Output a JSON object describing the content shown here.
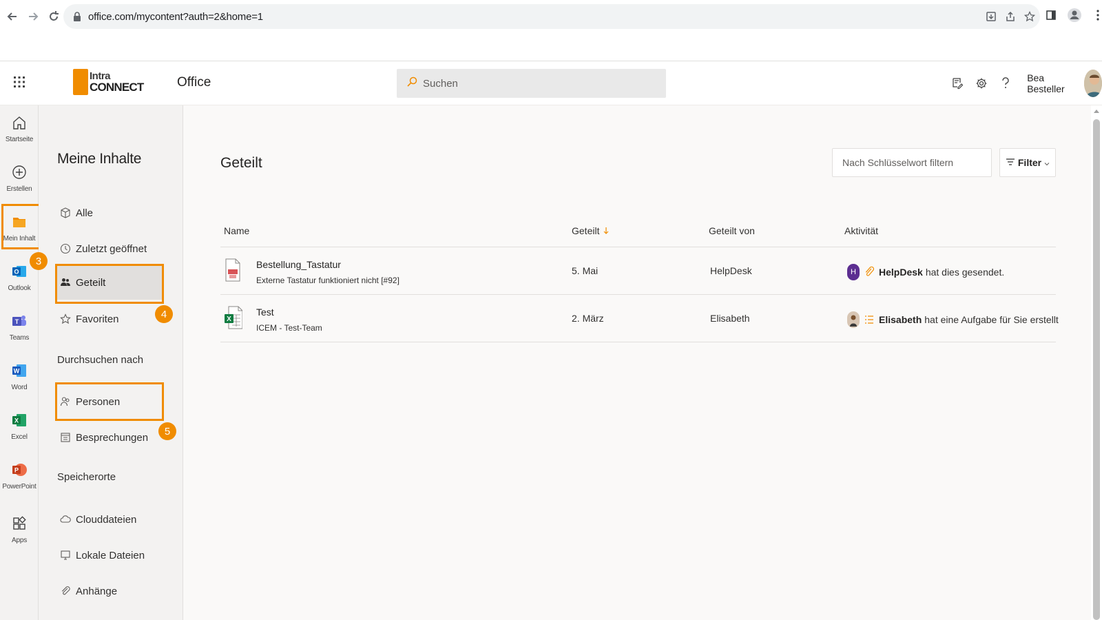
{
  "browser": {
    "url": "office.com/mycontent?auth=2&home=1"
  },
  "header": {
    "brand_line1": "Intra",
    "brand_line2": "CONNECT",
    "app_name": "Office",
    "search_placeholder": "Suchen",
    "user_name": "Bea Besteller"
  },
  "rail": {
    "items": [
      {
        "label": "Startseite",
        "icon": "home-icon"
      },
      {
        "label": "Erstellen",
        "icon": "plus-circle-icon"
      },
      {
        "label": "Mein Inhalt",
        "icon": "folder-icon"
      },
      {
        "label": "Outlook",
        "icon": "outlook-icon"
      },
      {
        "label": "Teams",
        "icon": "teams-icon"
      },
      {
        "label": "Word",
        "icon": "word-icon"
      },
      {
        "label": "Excel",
        "icon": "excel-icon"
      },
      {
        "label": "PowerPoint",
        "icon": "powerpoint-icon"
      },
      {
        "label": "Apps",
        "icon": "apps-icon"
      }
    ],
    "highlight_color": "#F08C00"
  },
  "badges": [
    "3",
    "4",
    "5"
  ],
  "sidebar": {
    "title": "Meine Inhalte",
    "items": [
      {
        "label": "Alle",
        "icon": "cube-icon"
      },
      {
        "label": "Zuletzt geöffnet",
        "icon": "clock-icon"
      },
      {
        "label": "Geteilt",
        "icon": "people-icon"
      },
      {
        "label": "Favoriten",
        "icon": "star-icon"
      }
    ],
    "browse_section": "Durchsuchen nach",
    "browse_items": [
      {
        "label": "Personen",
        "icon": "person-icon"
      },
      {
        "label": "Besprechungen",
        "icon": "calendar-icon"
      }
    ],
    "storage_section": "Speicherorte",
    "storage_items": [
      {
        "label": "Clouddateien",
        "icon": "cloud-icon"
      },
      {
        "label": "Lokale Dateien",
        "icon": "monitor-icon"
      },
      {
        "label": "Anhänge",
        "icon": "paperclip-icon"
      }
    ]
  },
  "main": {
    "title": "Geteilt",
    "filter_placeholder": "Nach Schlüsselwort filtern",
    "filter_button": "Filter",
    "columns": [
      "Name",
      "Geteilt",
      "Geteilt von",
      "Aktivität"
    ],
    "rows": [
      {
        "name": "Bestellung_Tastatur",
        "subtitle": "Externe Tastatur funktioniert nicht [#92]",
        "shared": "5. Mai",
        "shared_by": "HelpDesk",
        "activity_actor": "HelpDesk",
        "activity_text": "hat dies gesendet.",
        "avatar_letter": "H",
        "file_icon": "pdf-file-icon"
      },
      {
        "name": "Test",
        "subtitle": "ICEM - Test-Team",
        "shared": "2. März",
        "shared_by": "Elisabeth",
        "activity_actor": "Elisabeth",
        "activity_text": "hat eine Aufgabe für Sie erstellt",
        "avatar_letter": "",
        "file_icon": "excel-file-icon"
      }
    ]
  },
  "colors": {
    "accent": "#F08C00",
    "avatar_purple": "#5C2E91"
  }
}
